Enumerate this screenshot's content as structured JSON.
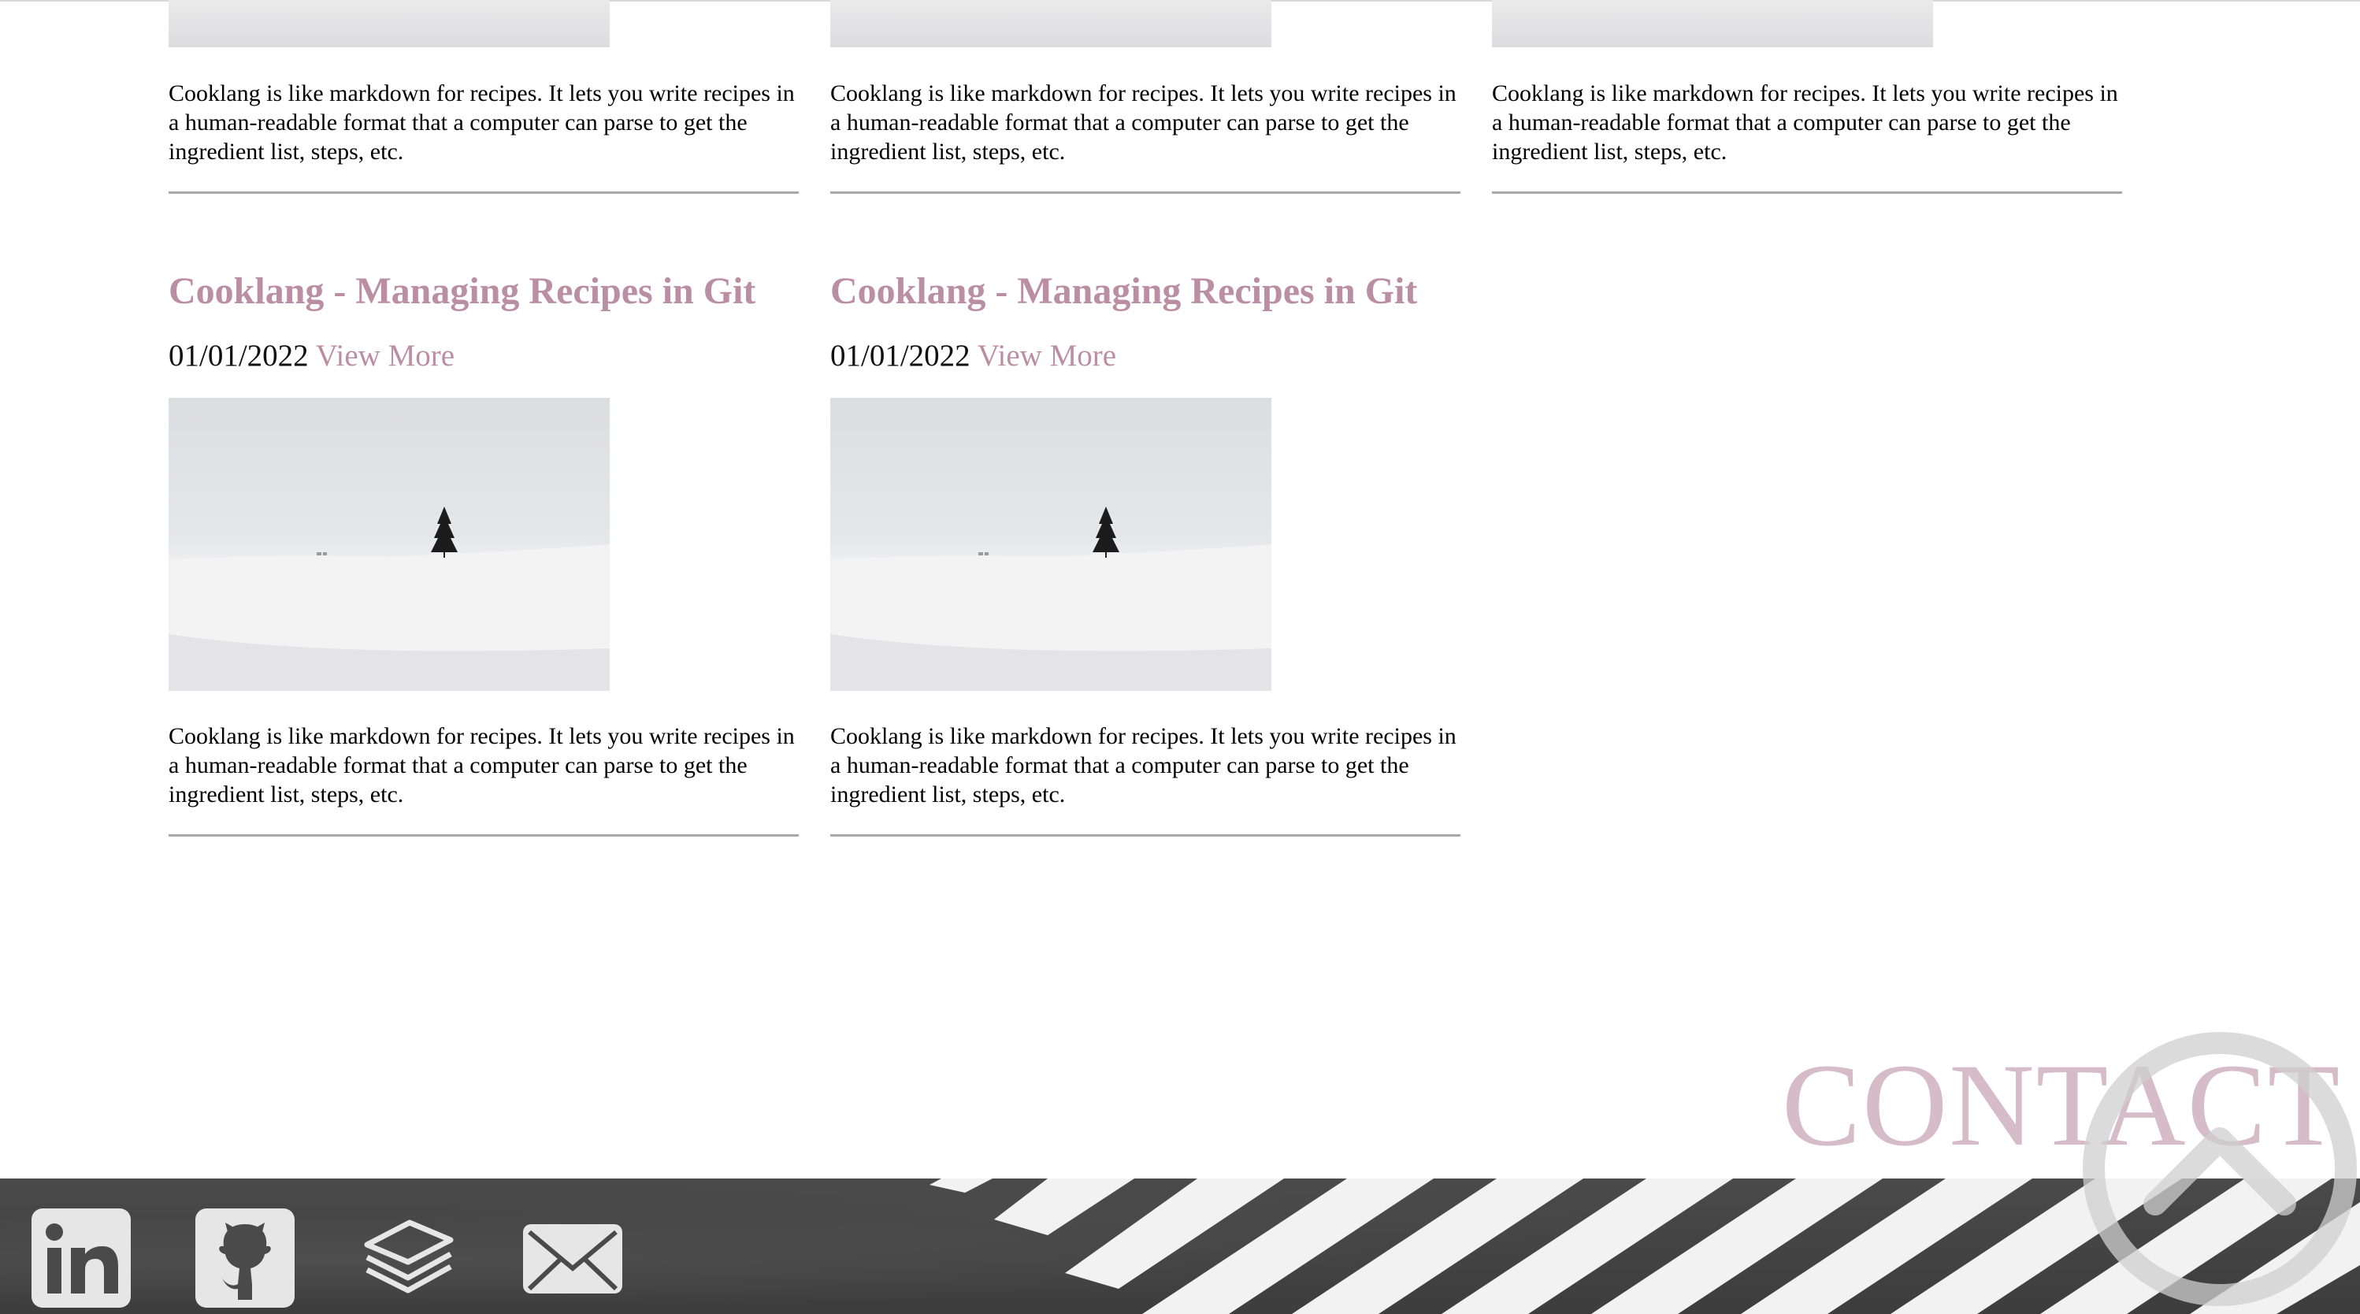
{
  "posts": [
    {
      "description": "Cooklang is like markdown for recipes. It lets you write recipes in a human-readable format that a computer can parse to get the ingredient list, steps, etc."
    },
    {
      "description": "Cooklang is like markdown for recipes. It lets you write recipes in a human-readable format that a computer can parse to get the ingredient list, steps, etc."
    },
    {
      "description": "Cooklang is like markdown for recipes. It lets you write recipes in a human-readable format that a computer can parse to get the ingredient list, steps, etc."
    },
    {
      "title": "Cooklang - Managing Recipes in Git",
      "date": "01/01/2022",
      "link_label": "View More",
      "description": "Cooklang is like markdown for recipes. It lets you write recipes in a human-readable format that a computer can parse to get the ingredient list, steps, etc."
    },
    {
      "title": "Cooklang - Managing Recipes in Git",
      "date": "01/01/2022",
      "link_label": "View More",
      "description": "Cooklang is like markdown for recipes. It lets you write recipes in a human-readable format that a computer can parse to get the ingredient list, steps, etc."
    }
  ],
  "footer": {
    "contact_label": "CONTACT",
    "social_icons": [
      "linkedin-icon",
      "github-icon",
      "stack-icon",
      "mail-icon"
    ]
  },
  "colors": {
    "accent": "#bb8fa3",
    "contact": "#d6bcc8",
    "footer_bg": "#424242"
  }
}
